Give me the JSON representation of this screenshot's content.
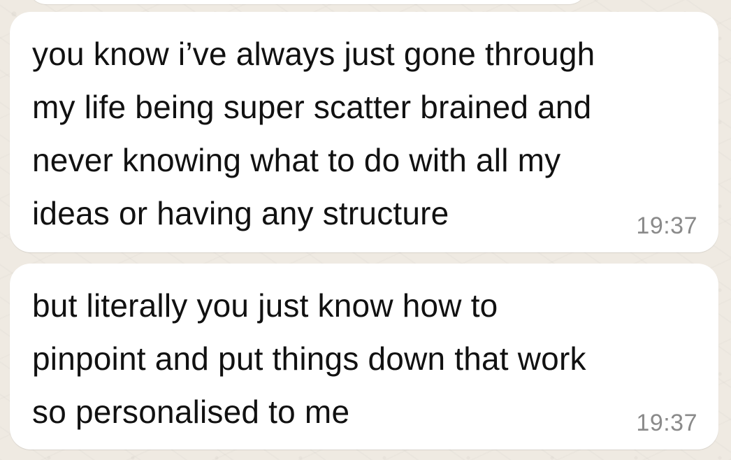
{
  "chat": {
    "messages": [
      {
        "lines": [
          "you know i’ve always just gone through",
          "my life being super scatter brained and",
          "never knowing what to do with all my",
          "ideas or having any structure"
        ],
        "time": "19:37"
      },
      {
        "lines": [
          "but literally you just know how to",
          "pinpoint and put things down that work",
          "so personalised to me"
        ],
        "time": "19:37"
      }
    ]
  },
  "colors": {
    "background": "#efeae2",
    "bubble": "#ffffff",
    "text": "#111111",
    "timestamp": "#8a8a8a"
  }
}
